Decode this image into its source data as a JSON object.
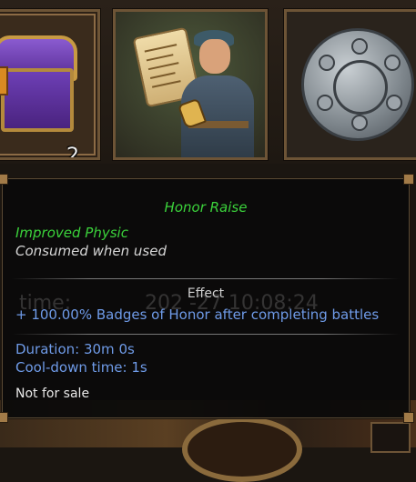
{
  "slots": [
    {
      "name": "treasure-chest",
      "count": "2"
    },
    {
      "name": "honor-raise-herald"
    },
    {
      "name": "silver-seal"
    }
  ],
  "tooltip": {
    "title": "Honor Raise",
    "subtitle": "Improved Physic",
    "consumed": "Consumed when used",
    "effect_header": "Effect",
    "effect": "+ 100.00%  Badges of Honor after completing battles",
    "duration": "Duration: 30m 0s",
    "cooldown": "Cool-down time: 1s",
    "sale": "Not for sale",
    "background_text_left": "time:",
    "background_text_right": "202  -27  10:08:24"
  },
  "colors": {
    "title": "#3bd23b",
    "effect": "#6f9be8",
    "frame": "#6d5436"
  }
}
